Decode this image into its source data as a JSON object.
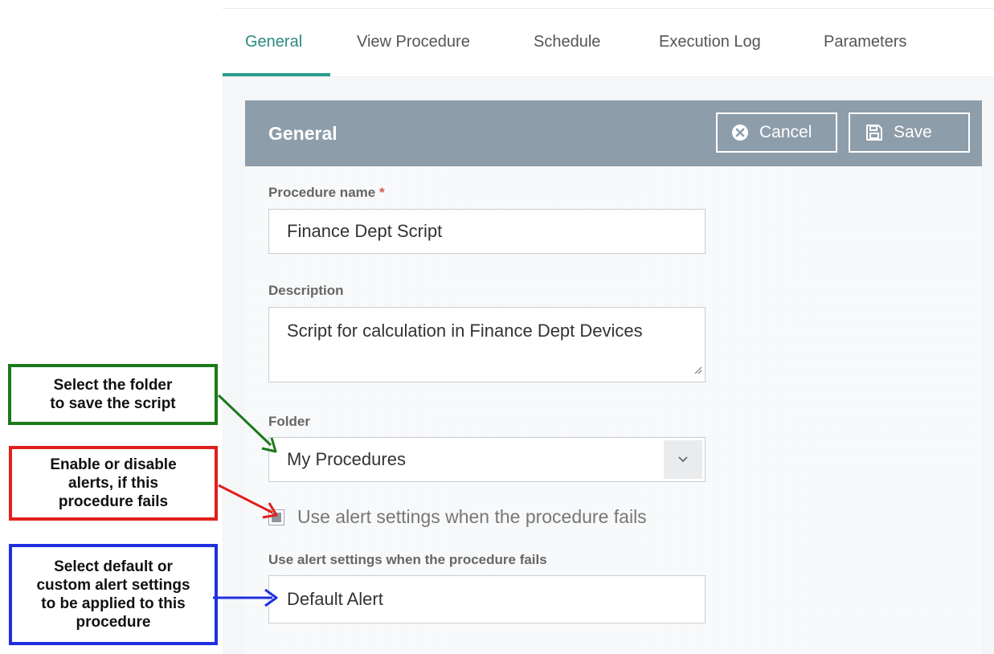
{
  "tabs": [
    {
      "label": "General",
      "active": true
    },
    {
      "label": "View Procedure",
      "active": false
    },
    {
      "label": "Schedule",
      "active": false
    },
    {
      "label": "Execution Log",
      "active": false
    },
    {
      "label": "Parameters",
      "active": false
    }
  ],
  "panel": {
    "title": "General",
    "cancel_label": "Cancel",
    "save_label": "Save"
  },
  "form": {
    "procedure_name_label": "Procedure name",
    "required_marker": "*",
    "procedure_name_value": "Finance Dept Script",
    "description_label": "Description",
    "description_value": "Script for calculation in Finance Dept Devices",
    "folder_label": "Folder",
    "folder_value": "My Procedures",
    "alert_checkbox_label": "Use alert settings when the procedure fails",
    "alert_checkbox_checked": true,
    "alert_setting_label": "Use alert settings when the procedure fails",
    "alert_setting_value": "Default Alert"
  },
  "callouts": {
    "folder": "Select the folder\nto save the script",
    "alerts": "Enable or disable\nalerts, if this\nprocedure fails",
    "alert_settings": "Select default or\ncustom alert settings\nto be applied to this\nprocedure"
  },
  "colors": {
    "accent": "#2a9d8f",
    "header": "#8e9daa",
    "callout_green": "#1a7a1a",
    "callout_red": "#e0201c",
    "callout_blue": "#1f2fe0"
  },
  "icons": {
    "cancel": "x-circle-icon",
    "save": "floppy-disk-icon",
    "select": "chevron-down-icon",
    "resize": "resize-handle-icon"
  }
}
